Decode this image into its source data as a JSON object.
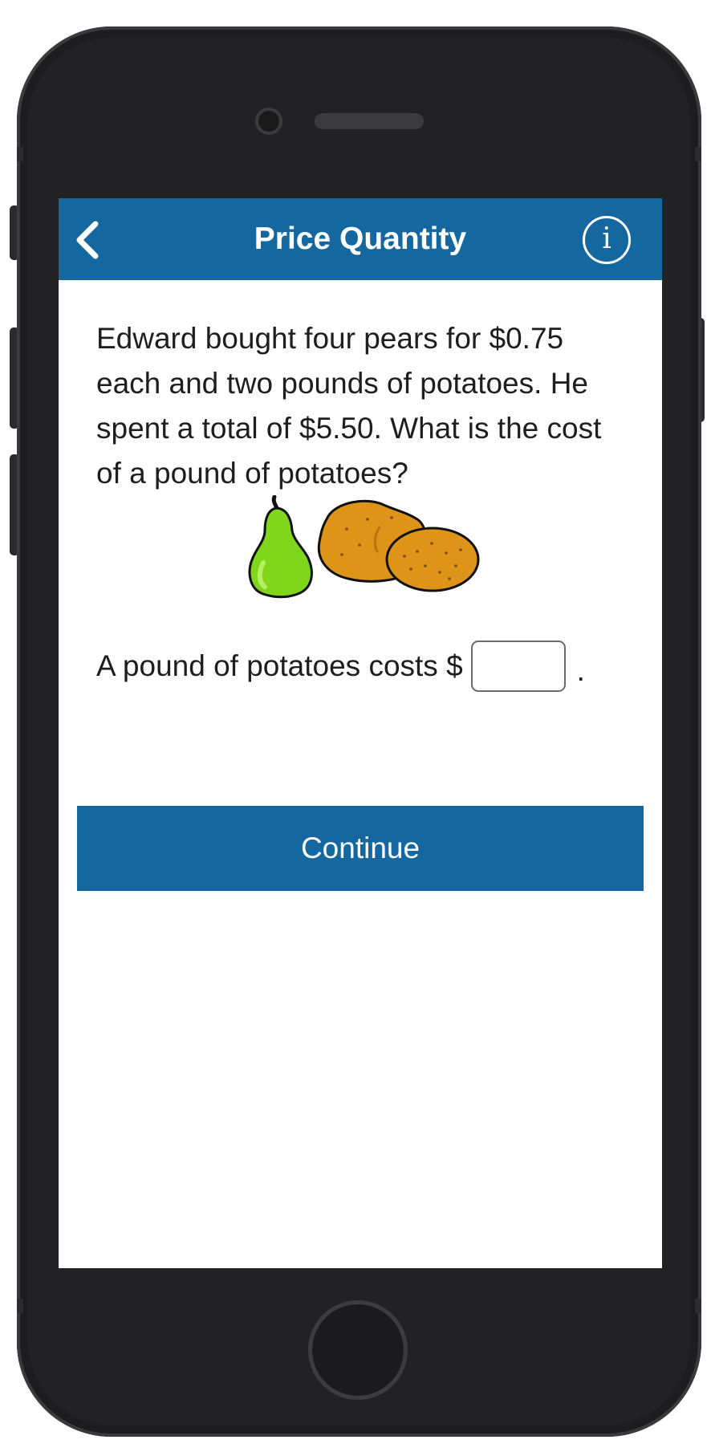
{
  "header": {
    "title": "Price Quantity",
    "back_icon": "chevron-left-icon",
    "info_label": "i"
  },
  "question": {
    "text": "Edward bought four pears for $0.75 each and two pounds of potatoes. He spent a total of $5.50. What is the cost of a pound of potatoes?"
  },
  "answer": {
    "prefix": "A pound of potatoes costs $",
    "value": "",
    "placeholder": "",
    "suffix": "."
  },
  "actions": {
    "continue_label": "Continue"
  },
  "colors": {
    "accent": "#15679f",
    "pear": "#7fd61b",
    "potato": "#dd9418",
    "device": "#222224"
  }
}
